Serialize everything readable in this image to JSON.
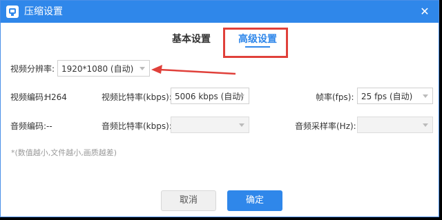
{
  "window": {
    "title": "压缩设置",
    "close_glyph": "✕"
  },
  "tabs": [
    {
      "label": "基本设置",
      "active": false
    },
    {
      "label": "高级设置",
      "active": true
    }
  ],
  "resolution": {
    "label": "视频分辨率:",
    "value": "1920*1080 (自动)"
  },
  "video_codec": {
    "label": "视频编码:",
    "value": "H264"
  },
  "video_bitrate": {
    "label": "视频比特率(kbps):",
    "value": "5006 kbps (自动)"
  },
  "framerate": {
    "label": "帧率(fps):",
    "value": "25 fps (自动)"
  },
  "audio_codec": {
    "label": "音频编码:",
    "value": "--"
  },
  "audio_bitrate": {
    "label": "音频比特率(kbps):",
    "value": ""
  },
  "audio_samplerate": {
    "label": "音频采样率(Hz):",
    "value": ""
  },
  "note": "*(数值越小,文件越小,画质越差)",
  "buttons": {
    "cancel": "取消",
    "ok": "确定"
  },
  "colors": {
    "accent": "#2f87ea",
    "annotation": "#e0403a"
  },
  "icons": {
    "app": "app-logo-icon",
    "close": "close-icon",
    "dropdown": "chevron-down-icon"
  }
}
